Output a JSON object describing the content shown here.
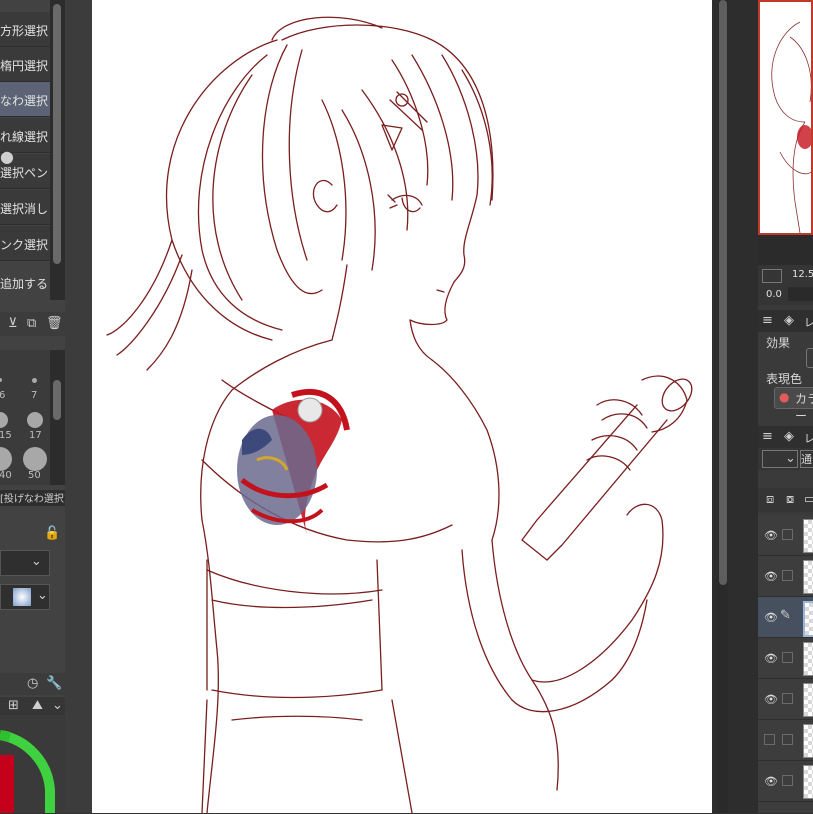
{
  "tools": [
    {
      "label": "方形選択",
      "selected": false
    },
    {
      "label": "楕円選択",
      "selected": false
    },
    {
      "label": "投げなわ選択",
      "selected": true
    },
    {
      "label": "折れ線選択",
      "selected": false
    },
    {
      "label": "選択ペン",
      "selected": false
    },
    {
      "label": "選択消し",
      "selected": false
    },
    {
      "label": "シュリンク選択",
      "selected": false
    }
  ],
  "add_label": "追加する",
  "brush_sizes": [
    "6",
    "7",
    "15",
    "17",
    "40",
    "50"
  ],
  "subtool_title": "[投げなわ選択]",
  "right": {
    "zoom_value": "12.5",
    "rotate_value": "0.0",
    "effect_label": "効果",
    "expression_color_label": "表現色",
    "color_button": "カラー",
    "tab_layer_property": "レ",
    "tab_layer": "レ",
    "blend_mode": "通常"
  },
  "colors": {
    "selected_tool": "#5b6375",
    "line_art": "#7a1e1e",
    "nav_border": "#c0392b"
  },
  "icons": [
    "eye-icon",
    "pencil-icon",
    "lock-icon",
    "trash-icon",
    "wrench-icon"
  ]
}
